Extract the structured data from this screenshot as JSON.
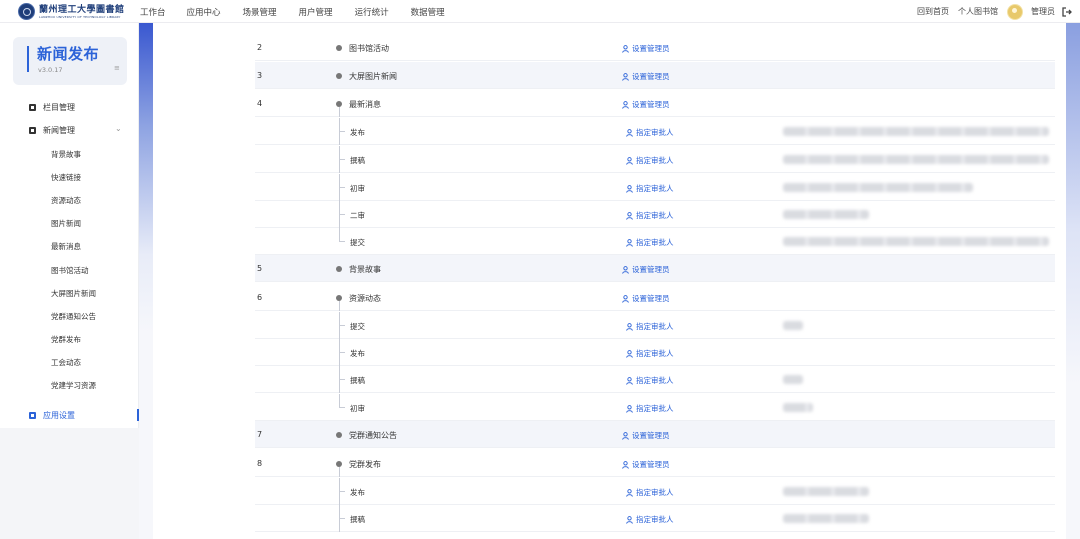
{
  "header": {
    "logo_text": "蘭州理工大學圖書館",
    "logo_subtext": "LANZHOU UNIVERSITY OF TECHNOLOGY LIBRARY",
    "nav": [
      "工作台",
      "应用中心",
      "场景管理",
      "用户管理",
      "运行统计",
      "数据管理"
    ],
    "links": {
      "home": "回到首页",
      "personal": "个人图书馆",
      "admin": "管理员"
    }
  },
  "sidebar": {
    "brand_title": "新闻发布",
    "version": "v3.0.17",
    "menu_icon": "≡",
    "groups": {
      "column": "栏目管理",
      "news": "新闻管理",
      "settings": "应用设置"
    },
    "chevron": "⌄",
    "sub_items": [
      "背景故事",
      "快速链接",
      "资源动态",
      "图片新闻",
      "最新消息",
      "图书馆活动",
      "大屏图片新闻",
      "党群通知公告",
      "党群发布",
      "工会动态",
      "党建学习资源"
    ]
  },
  "table": {
    "rows": [
      {
        "num": "2",
        "name": "图书馆活动",
        "action": "设置管理员"
      },
      {
        "num": "3",
        "name": "大屏图片新闻",
        "action": "设置管理员"
      },
      {
        "num": "4",
        "name": "最新消息",
        "action": "设置管理员"
      },
      {
        "name": "发布",
        "action": "指定审批人"
      },
      {
        "name": "撰稿",
        "action": "指定审批人"
      },
      {
        "name": "初审",
        "action": "指定审批人"
      },
      {
        "name": "二审",
        "action": "指定审批人"
      },
      {
        "name": "提交",
        "action": "指定审批人"
      },
      {
        "num": "5",
        "name": "背景故事",
        "action": "设置管理员"
      },
      {
        "num": "6",
        "name": "资源动态",
        "action": "设置管理员"
      },
      {
        "name": "提交",
        "action": "指定审批人"
      },
      {
        "name": "发布",
        "action": "指定审批人"
      },
      {
        "name": "撰稿",
        "action": "指定审批人"
      },
      {
        "name": "初审",
        "action": "指定审批人"
      },
      {
        "num": "7",
        "name": "党群通知公告",
        "action": "设置管理员"
      },
      {
        "num": "8",
        "name": "党群发布",
        "action": "设置管理员"
      },
      {
        "name": "发布",
        "action": "指定审批人"
      },
      {
        "name": "撰稿",
        "action": "指定审批人"
      }
    ]
  },
  "colors": {
    "accent": "#2c63d8",
    "brand_bg": "#eef1f7",
    "row_alt": "#f3f5fa"
  }
}
